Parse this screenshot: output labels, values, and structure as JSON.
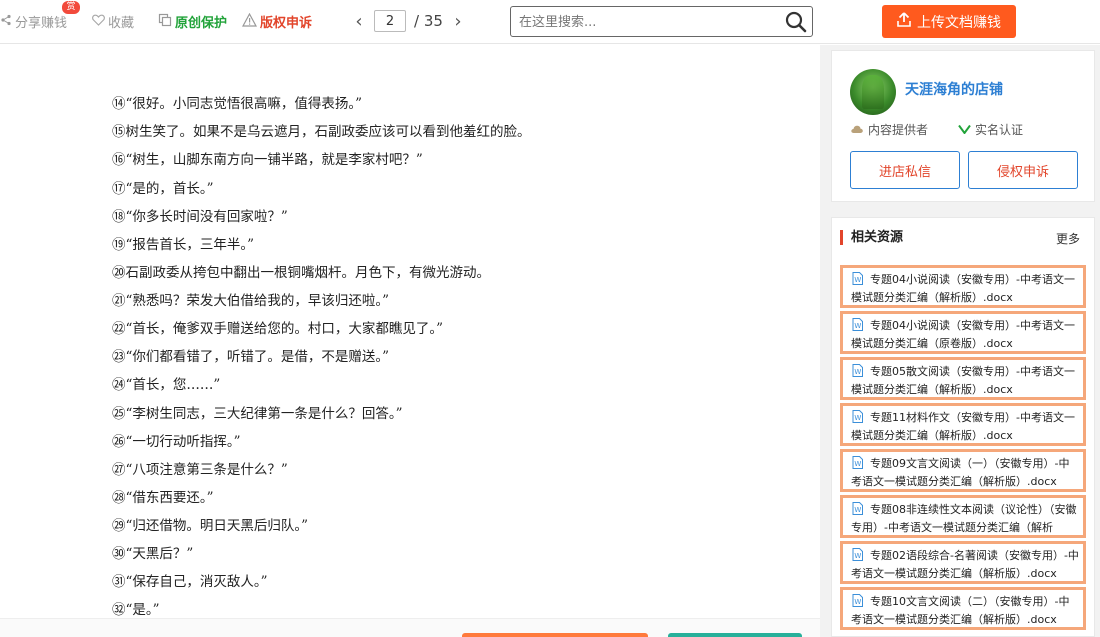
{
  "toolbar": {
    "share_label": "分享赚钱",
    "share_badge": "赏",
    "fav_label": "收藏",
    "original_label": "原创保护",
    "copyright_label": "版权申诉"
  },
  "pager": {
    "current_page": "2",
    "total": "/ 35"
  },
  "search": {
    "placeholder": "在这里搜索..."
  },
  "upload": {
    "label": "上传文档赚钱"
  },
  "document": {
    "lines": [
      "⑭“很好。小同志觉悟很高嘛，值得表扬。”",
      "⑮树生笑了。如果不是乌云遮月，石副政委应该可以看到他羞红的脸。",
      "⑯“树生，山脚东南方向一铺半路，就是李家村吧？”",
      "⑰“是的，首长。”",
      "⑱“你多长时间没有回家啦？”",
      "⑲“报告首长，三年半。”",
      "⑳石副政委从挎包中翻出一根铜嘴烟杆。月色下，有微光游动。",
      "㉑“熟悉吗？荣发大伯借给我的，早该归还啦。”",
      "㉒“首长，俺爹双手赠送给您的。村口，大家都瞧见了。”",
      "㉓“你们都看错了，听错了。是借，不是赠送。”",
      "㉔“首长，您……”",
      "㉕“李树生同志，三大纪律第一条是什么？回答。”",
      "㉖“一切行动听指挥。”",
      "㉗“八项注意第三条是什么？”",
      "㉘“借东西要还。”",
      "㉙“归还借物。明日天黑后归队。”",
      "㉚“天黑后？”",
      "㉛“保存自己，消灭敌人。”",
      "㉜“是。”"
    ]
  },
  "shop": {
    "name": "天涯海角的店铺",
    "provider_label": "内容提供者",
    "verified_label": "实名认证",
    "message_button": "进店私信",
    "complaint_button": "侵权申诉"
  },
  "related": {
    "title": "相关资源",
    "more": "更多",
    "items": [
      "专题04小说阅读（安徽专用）-中考语文一模试题分类汇编（解析版）.docx",
      "专题04小说阅读（安徽专用）-中考语文一模试题分类汇编（原卷版）.docx",
      "专题05散文阅读（安徽专用）-中考语文一模试题分类汇编（解析版）.docx",
      "专题11材料作文（安徽专用）-中考语文一模试题分类汇编（解析版）.docx",
      "专题09文言文阅读（一）（安徽专用）-中考语文一模试题分类汇编（解析版）.docx",
      "专题08非连续性文本阅读（议论性）（安徽专用）-中考语文一模试题分类汇编（解析",
      "专题02语段综合-名著阅读（安徽专用）-中考语文一模试题分类汇编（解析版）.docx",
      "专题10文言文阅读（二）（安徽专用）-中考语文一模试题分类汇编（解析版）.docx"
    ]
  },
  "colors": {
    "accent_orange": "#ff5a1e",
    "link_blue": "#2d7fd3",
    "alert_red": "#e2452b",
    "protect_green": "#22a33a",
    "item_border": "#f5a77a"
  }
}
